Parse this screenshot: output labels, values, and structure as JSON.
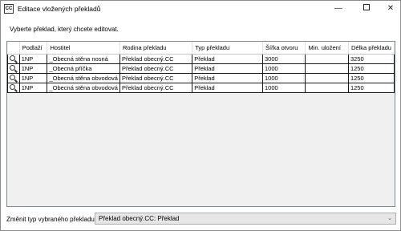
{
  "window": {
    "app_icon_text": "CC",
    "title": "Editace vložených překladů"
  },
  "instruction": "Vyberte překlad, který chcete editovat.",
  "table": {
    "columns": [
      "",
      "Podlaží",
      "Hostitel",
      "Rodina překladu",
      "Typ překladu",
      "Šířka otvoru",
      "Min. uložení",
      "Délka překladu"
    ],
    "rows": [
      {
        "floor": "1NP",
        "host": "_Obecná stěna nosná",
        "family": "Překlad obecný.CC",
        "type": "Překlad",
        "width": "3000",
        "min_support": "",
        "length": "3250"
      },
      {
        "floor": "1NP",
        "host": "_Obecná příčka",
        "family": "Překlad obecný.CC",
        "type": "Překlad",
        "width": "1000",
        "min_support": "",
        "length": "1250"
      },
      {
        "floor": "1NP",
        "host": "_Obecná stěna obvodová",
        "family": "Překlad obecný.CC",
        "type": "Překlad",
        "width": "1000",
        "min_support": "",
        "length": "1250"
      },
      {
        "floor": "1NP",
        "host": "_Obecná stěna obvodová",
        "family": "Překlad obecný.CC",
        "type": "Překlad",
        "width": "1000",
        "min_support": "",
        "length": "1250"
      }
    ]
  },
  "change_type": {
    "label": "Změnit typ vybraného překladu:",
    "selected": "Překlad obecný.CC: Překlad"
  },
  "icons": {
    "row_icon": "magnifier-icon",
    "dropdown": "chevron-down-icon"
  }
}
